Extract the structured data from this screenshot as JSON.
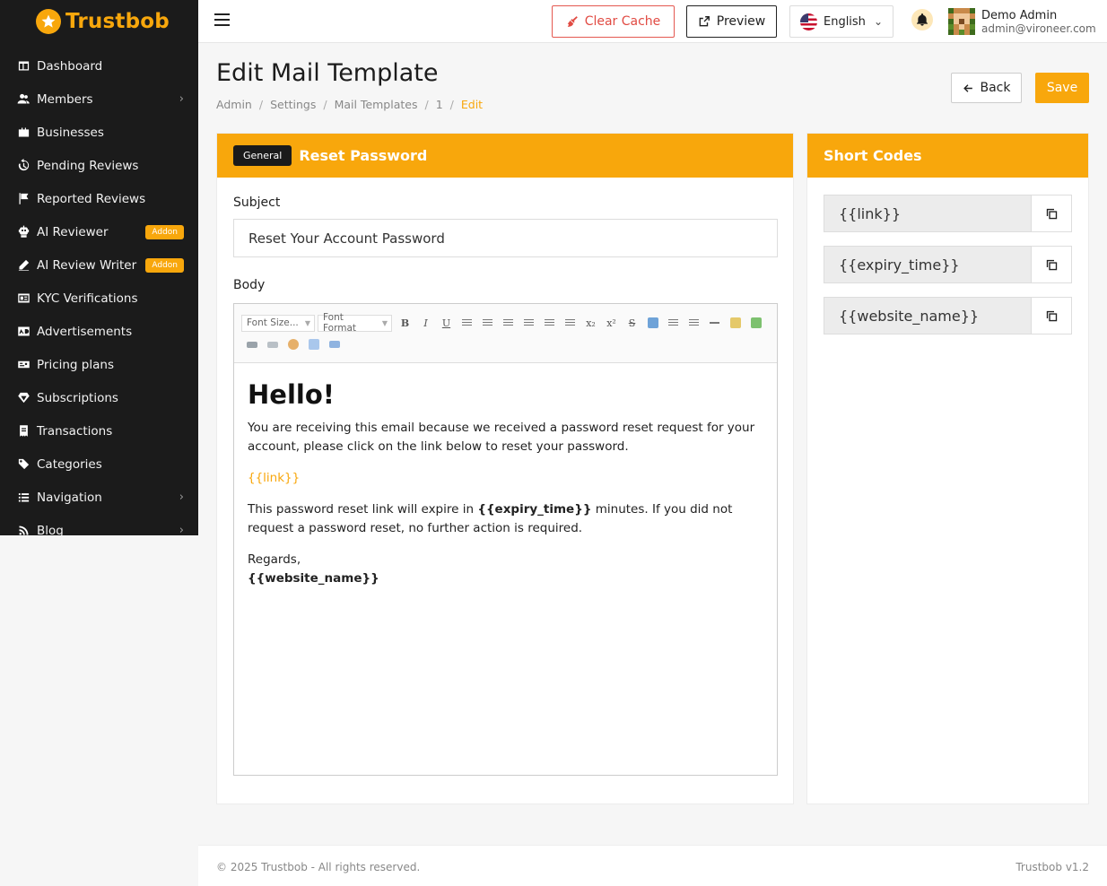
{
  "brand": {
    "name": "Trustbob",
    "color": "#f8a70c"
  },
  "sidebar": {
    "items": [
      {
        "label": "Dashboard",
        "icon": "dashboard-icon",
        "chevron": false,
        "badge": ""
      },
      {
        "label": "Members",
        "icon": "users-icon",
        "chevron": true,
        "badge": ""
      },
      {
        "label": "Businesses",
        "icon": "briefcase-icon",
        "chevron": false,
        "badge": ""
      },
      {
        "label": "Pending Reviews",
        "icon": "history-icon",
        "chevron": false,
        "badge": ""
      },
      {
        "label": "Reported Reviews",
        "icon": "flag-icon",
        "chevron": false,
        "badge": ""
      },
      {
        "label": "AI Reviewer",
        "icon": "robot-icon",
        "chevron": false,
        "badge": "Addon"
      },
      {
        "label": "AI Review Writer",
        "icon": "pen-icon",
        "chevron": false,
        "badge": "Addon"
      },
      {
        "label": "KYC Verifications",
        "icon": "id-card-icon",
        "chevron": false,
        "badge": ""
      },
      {
        "label": "Advertisements",
        "icon": "ad-icon",
        "chevron": false,
        "badge": ""
      },
      {
        "label": "Pricing plans",
        "icon": "price-tag-icon",
        "chevron": false,
        "badge": ""
      },
      {
        "label": "Subscriptions",
        "icon": "gem-icon",
        "chevron": false,
        "badge": ""
      },
      {
        "label": "Transactions",
        "icon": "receipt-icon",
        "chevron": false,
        "badge": ""
      },
      {
        "label": "Categories",
        "icon": "tags-icon",
        "chevron": false,
        "badge": ""
      },
      {
        "label": "Navigation",
        "icon": "list-icon",
        "chevron": true,
        "badge": ""
      },
      {
        "label": "Blog",
        "icon": "rss-icon",
        "chevron": true,
        "badge": ""
      }
    ]
  },
  "topbar": {
    "clear_cache": "Clear Cache",
    "preview": "Preview",
    "language": "English",
    "user_name": "Demo Admin",
    "user_email": "admin@vironeer.com"
  },
  "page": {
    "title": "Edit Mail Template",
    "breadcrumb": [
      "Admin",
      "Settings",
      "Mail Templates",
      "1",
      "Edit"
    ],
    "back": "Back",
    "save": "Save"
  },
  "template": {
    "group": "General",
    "name": "Reset Password",
    "subject_label": "Subject",
    "subject": "Reset Your Account Password",
    "body_label": "Body",
    "toolbar": {
      "font_size": "Font Size...",
      "font_format": "Font Format"
    },
    "body": {
      "heading": "Hello!",
      "p1": "You are receiving this email because we received a password reset request for your account, please click on the link below to reset your password.",
      "link": "{{link}}",
      "p2_before": "This password reset link will expire in ",
      "p2_code": "{{expiry_time}}",
      "p2_after": " minutes. If you did not request a password reset, no further action is required.",
      "regards": "Regards,",
      "signature": "{{website_name}}"
    }
  },
  "shortcodes": {
    "title": "Short Codes",
    "items": [
      "{{link}}",
      "{{expiry_time}}",
      "{{website_name}}"
    ]
  },
  "footer": {
    "copyright": "© 2025 Trustbob - All rights reserved.",
    "version": "Trustbob v1.2"
  }
}
